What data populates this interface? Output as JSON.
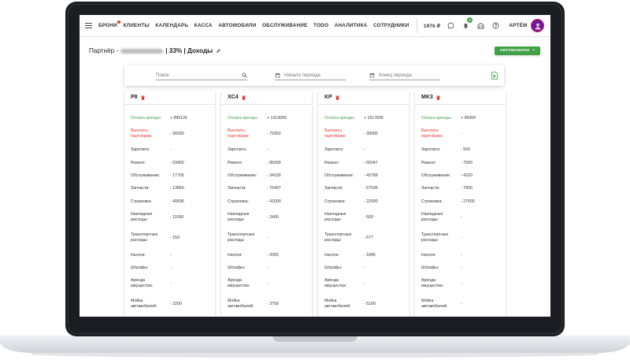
{
  "nav": {
    "links": [
      "БРОНИ",
      "КЛИЕНТЫ",
      "КАЛЕНДАРЬ",
      "КАССА",
      "АВТОМОБИЛИ",
      "ОБСЛУЖИВАНИЕ",
      "TODO",
      "АНАЛИТИКА",
      "СОТРУДНИКИ"
    ],
    "balance": "1976 ₽",
    "notifications_count": "2",
    "user_name": "АРТЁМ"
  },
  "header": {
    "title_prefix": "Партнёр - ",
    "title_suffix": " | 33% | Доходы",
    "add_button_label": "АВТОМОБИЛИ",
    "add_button_icon": "+"
  },
  "filters": {
    "search_placeholder": "Поиск",
    "period_start_placeholder": "Начало периода",
    "period_end_placeholder": "Конец периода"
  },
  "row_labels": [
    "Оплата аренды:",
    "Выплаты партнёрам:",
    "Зарплата:",
    "Ремонт:",
    "Обслуживание:",
    "Запчасти:",
    "Страховка:",
    "Накладные расходы:",
    "Транспортные расходы:",
    "Налоги:",
    "Штрафы:",
    "Аренда имущества:",
    "Мойка автомобилей:"
  ],
  "cars": [
    {
      "name": "P8",
      "values": [
        "+ 895126",
        "- 30000",
        "-",
        "- 53450",
        "- 17705",
        "- 13850",
        "- 40696",
        "- 11590",
        "- 150",
        "-",
        "-",
        "-",
        "- 2200"
      ]
    },
    {
      "name": "XC4",
      "values": [
        "+ 1313000",
        "- 79362",
        "-",
        "- 85000",
        "- 34190",
        "- 75497",
        "- 41000",
        "- 2400",
        "-",
        "- 2055",
        "-",
        "-",
        "- 3750"
      ]
    },
    {
      "name": "KP",
      "values": [
        "+ 1517600",
        "- 30000",
        "-",
        "- 55047",
        "- 43789",
        "- 57536",
        "- 22500",
        "- 500",
        "- 677",
        "- 1845",
        "-",
        "-",
        "- 5100"
      ]
    },
    {
      "name": "MK3",
      "values": [
        "+ 45000",
        "-",
        "- 500",
        "- 7000",
        "- 4320",
        "- 7900",
        "- 27500",
        "-",
        "-",
        "-",
        "-",
        "-",
        "-"
      ]
    }
  ],
  "colors": {
    "accent_green": "#43a047",
    "alert_red": "#e53935",
    "avatar_purple": "#6a1b9a"
  }
}
